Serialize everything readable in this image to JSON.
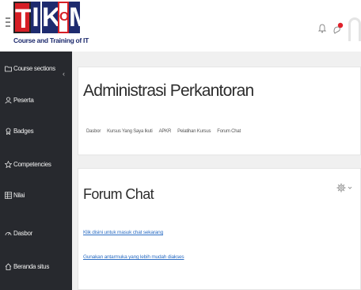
{
  "header": {
    "logo_sub": "Course and Training of IT",
    "logo_letters": [
      "T",
      "I",
      "K",
      "O",
      "M"
    ]
  },
  "sidebar": {
    "items": [
      {
        "label": "Course sections",
        "icon": "folder-icon"
      },
      {
        "label": "Peserta",
        "icon": "users-icon"
      },
      {
        "label": "Badges",
        "icon": "badge-icon"
      },
      {
        "label": "Competencies",
        "icon": "star-icon"
      },
      {
        "label": "Nilai",
        "icon": "grades-icon"
      },
      {
        "label": "Dasbor",
        "icon": "dashboard-icon"
      },
      {
        "label": "Beranda situs",
        "icon": "home-icon"
      }
    ]
  },
  "course": {
    "title": "Administrasi Perkantoran",
    "breadcrumb": [
      "Dasbor",
      "Kursus Yang Saya Ikuti",
      "APKR",
      "Pelatihan Kursus",
      "Forum Chat"
    ]
  },
  "chat": {
    "title": "Forum Chat",
    "link_enter": "Klik disini untuk masuk chat sekarang",
    "link_accessible": "Gunakan antarmuka yang lebih mudah diakses"
  },
  "colors": {
    "sidebar_bg": "#27292e",
    "link": "#2e6fc4",
    "notification_dot": "#e0212b"
  }
}
